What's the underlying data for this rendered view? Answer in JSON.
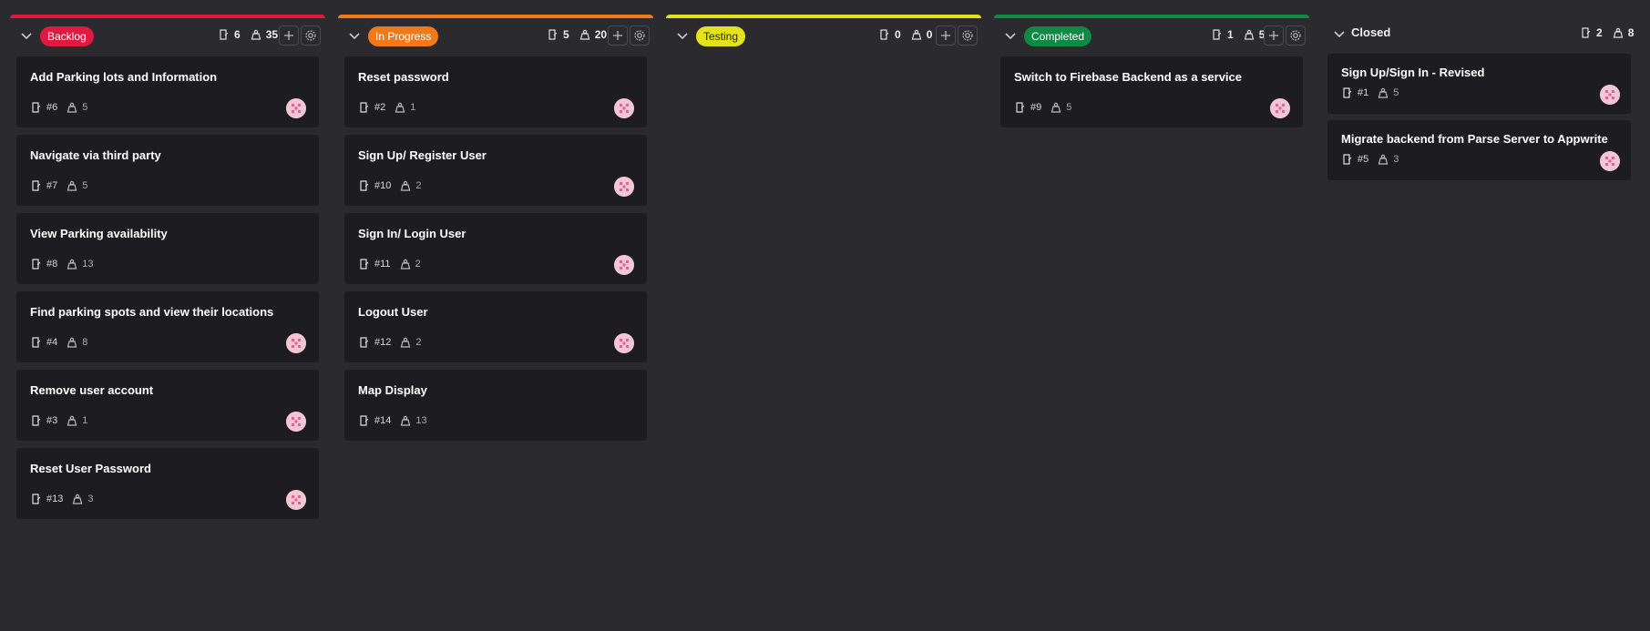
{
  "columns": [
    {
      "name": "Backlog",
      "color": "#e0193f",
      "issue_count": "6",
      "points": "35",
      "cards": [
        {
          "title": "Add Parking lots and Information",
          "number": "#6",
          "points": "5",
          "avatar": true
        },
        {
          "title": "Navigate via third party",
          "number": "#7",
          "points": "5",
          "avatar": false
        },
        {
          "title": "View Parking availability",
          "number": "#8",
          "points": "13",
          "avatar": false
        },
        {
          "title": "Find parking spots and view their locations",
          "number": "#4",
          "points": "8",
          "avatar": true
        },
        {
          "title": "Remove user account",
          "number": "#3",
          "points": "1",
          "avatar": true
        },
        {
          "title": "Reset User Password",
          "number": "#13",
          "points": "3",
          "avatar": true
        }
      ]
    },
    {
      "name": "In Progress",
      "color": "#f07a1a",
      "issue_count": "5",
      "points": "20",
      "cards": [
        {
          "title": "Reset password",
          "number": "#2",
          "points": "1",
          "avatar": true
        },
        {
          "title": "Sign Up/ Register User",
          "number": "#10",
          "points": "2",
          "avatar": true
        },
        {
          "title": "Sign In/ Login User",
          "number": "#11",
          "points": "2",
          "avatar": true
        },
        {
          "title": "Logout User",
          "number": "#12",
          "points": "2",
          "avatar": true
        },
        {
          "title": "Map Display",
          "number": "#14",
          "points": "13",
          "avatar": false
        }
      ]
    },
    {
      "name": "Testing",
      "color": "#e4e21a",
      "issue_count": "0",
      "points": "0",
      "cards": []
    },
    {
      "name": "Completed",
      "color": "#0f8a45",
      "issue_count": "1",
      "points": "5",
      "cards": [
        {
          "title": "Switch to Firebase Backend as a service",
          "number": "#9",
          "points": "5",
          "avatar": true
        }
      ]
    }
  ],
  "closed": {
    "name": "Closed",
    "issue_count": "2",
    "points": "8",
    "cards": [
      {
        "title": "Sign Up/Sign In - Revised",
        "number": "#1",
        "points": "5",
        "avatar": true
      },
      {
        "title": "Migrate backend from Parse Server to Appwrite",
        "number": "#5",
        "points": "3",
        "avatar": true
      }
    ]
  },
  "icons": {
    "collapse": "chevron-down-icon",
    "issue": "issue-icon",
    "points": "weight-icon",
    "add": "plus-icon",
    "settings": "gear-icon"
  }
}
